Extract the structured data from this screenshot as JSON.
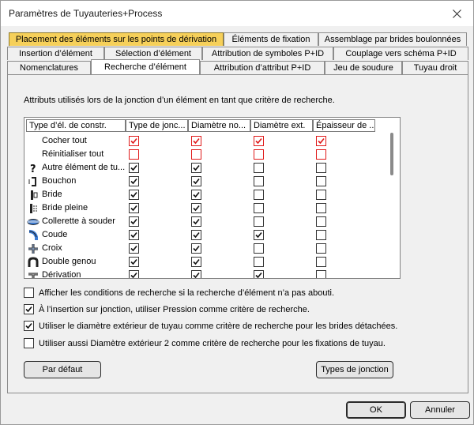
{
  "window": {
    "title": "Paramètres de Tuyauteries+Process"
  },
  "tabs": {
    "row1": [
      "Placement des éléments sur les points de dérivation",
      "Éléments de fixation",
      "Assemblage par brides boulonnées"
    ],
    "row2": [
      "Insertion d’élément",
      "Sélection d’élément",
      "Attribution de symboles P+ID",
      "Couplage vers schéma P+ID"
    ],
    "row3": [
      "Nomenclatures",
      "Recherche d’élément",
      "Attribution d’attribut P+ID",
      "Jeu de soudure",
      "Tuyau droit"
    ],
    "highlight_color": "#f6d05a",
    "active": "Recherche d’élément"
  },
  "panel": {
    "description": "Attributs utilisés lors de la jonction d’un élément en tant que critère de recherche.",
    "columns": [
      "Type d’él. de constr.",
      "Type de jonc...",
      "Diamètre no...",
      "Diamètre ext.",
      "Épaisseur de ..."
    ],
    "rows": [
      {
        "name": "Cocher tout",
        "icon": "",
        "checks": [
          true,
          true,
          true,
          true
        ],
        "red": true
      },
      {
        "name": "Réinitialiser tout",
        "icon": "",
        "checks": [
          false,
          false,
          false,
          false
        ],
        "red": true
      },
      {
        "name": "Autre élément de tu...",
        "icon": "question-icon",
        "checks": [
          true,
          true,
          false,
          false
        ],
        "red": false
      },
      {
        "name": "Bouchon",
        "icon": "cap-icon",
        "checks": [
          true,
          true,
          false,
          false
        ],
        "red": false
      },
      {
        "name": "Bride",
        "icon": "flange-icon",
        "checks": [
          true,
          true,
          false,
          false
        ],
        "red": false
      },
      {
        "name": "Bride pleine",
        "icon": "blind-flange-icon",
        "checks": [
          true,
          true,
          false,
          false
        ],
        "red": false
      },
      {
        "name": "Collerette à souder",
        "icon": "weld-neck-icon",
        "checks": [
          true,
          true,
          false,
          false
        ],
        "red": false
      },
      {
        "name": "Coude",
        "icon": "elbow-icon",
        "checks": [
          true,
          true,
          true,
          false
        ],
        "red": false
      },
      {
        "name": "Croix",
        "icon": "cross-icon",
        "checks": [
          true,
          true,
          false,
          false
        ],
        "red": false
      },
      {
        "name": "Double genou",
        "icon": "double-knee-icon",
        "checks": [
          true,
          true,
          false,
          false
        ],
        "red": false
      },
      {
        "name": "Dérivation",
        "icon": "tee-icon",
        "checks": [
          true,
          true,
          true,
          false
        ],
        "red": false
      }
    ],
    "options": [
      {
        "label": "Afficher les conditions de recherche si la recherche d’élément n’a pas abouti.",
        "checked": false
      },
      {
        "label": "À l’insertion sur jonction, utiliser Pression comme critère de recherche.",
        "checked": true
      },
      {
        "label": "Utiliser le diamètre extérieur de tuyau comme critère de recherche pour les brides détachées.",
        "checked": true
      },
      {
        "label": "Utiliser aussi Diamètre extérieur 2 comme critère de recherche pour les fixations de tuyau.",
        "checked": false
      }
    ],
    "default_button": "Par défaut",
    "junction_types_button": "Types de jonction"
  },
  "footer": {
    "ok": "OK",
    "cancel": "Annuler"
  },
  "colors": {
    "red_check": "#e01b1b",
    "dialog_bg": "#f0f0f0"
  }
}
